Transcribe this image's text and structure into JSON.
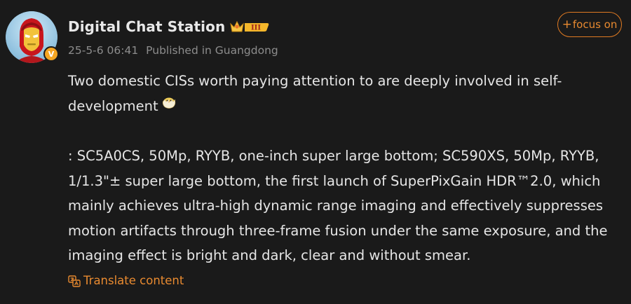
{
  "author": {
    "name": "Digital Chat Station",
    "avatar_icon": "iron-man-avatar-icon",
    "verified_badge": "V",
    "level_badge_icon": "crown-level-icon",
    "level_text": "III"
  },
  "meta": {
    "timestamp": "25-5-6 06:41",
    "location": "Published in Guangdong"
  },
  "follow_button": {
    "plus": "+",
    "label": "focus on"
  },
  "post": {
    "paragraph_1": "Two domestic CISs worth paying attention to are deeply involved in self-development",
    "emoji_icon": "hatching-chick-icon",
    "paragraph_2": ": SC5A0CS, 50Mp, RYYB, one-inch super large bottom; SC590XS, 50Mp, RYYB, 1/1.3\"± super large bottom, the first launch of SuperPixGain HDR™2.0, which mainly achieves ultra-high dynamic range imaging and effectively suppresses motion artifacts through three-frame fusion under the same exposure, and the imaging effect is bright and dark, clear and without smear."
  },
  "translate": {
    "label": "Translate content",
    "icon": "translate-icon"
  },
  "colors": {
    "background": "#1a1a1a",
    "accent": "#e88a30",
    "text": "#e6e6e6",
    "meta": "#8d8d8d"
  }
}
